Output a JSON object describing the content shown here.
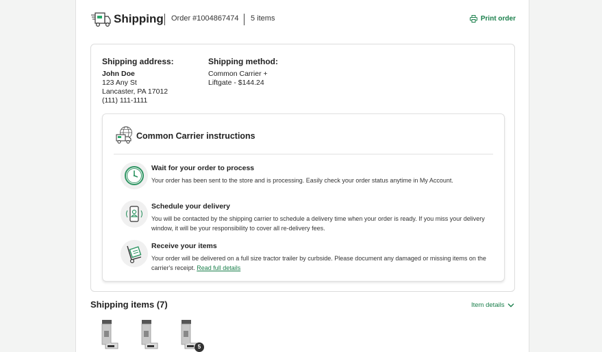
{
  "header": {
    "title": "Shipping",
    "order": "Order #1004867474",
    "items_count": "5 items",
    "print_label": "Print order"
  },
  "address": {
    "heading": "Shipping address:",
    "name": "John Doe",
    "street": "123 Any St",
    "city": "Lancaster, PA 17012",
    "phone": "(111) 111-1111"
  },
  "method": {
    "heading": "Shipping method:",
    "line1": "Common Carrier +",
    "line2": "Liftgate - $144.24"
  },
  "instructions": {
    "title": "Common Carrier instructions",
    "steps": [
      {
        "title": "Wait for your order to process",
        "desc": "Your order has been sent to the store and is processing. Easily check your order status anytime in My Account."
      },
      {
        "title": "Schedule your delivery",
        "desc": "You will be contacted by the shipping carrier to schedule a delivery time when your order is ready. If you miss your delivery window, it will be your responsibility to cover all re-delivery fees."
      },
      {
        "title": "Receive your items",
        "desc": "Your order will be delivered on a full size tractor trailer by curbside. Please document any damaged or missing items on the carrier's receipt.",
        "link": "Read full details"
      }
    ]
  },
  "shipping_items": {
    "title": "Shipping items (7)",
    "details_label": "Item details",
    "more_badge": "5"
  },
  "colors": {
    "accent": "#1a7f4b",
    "background": "#f3f4f3"
  }
}
